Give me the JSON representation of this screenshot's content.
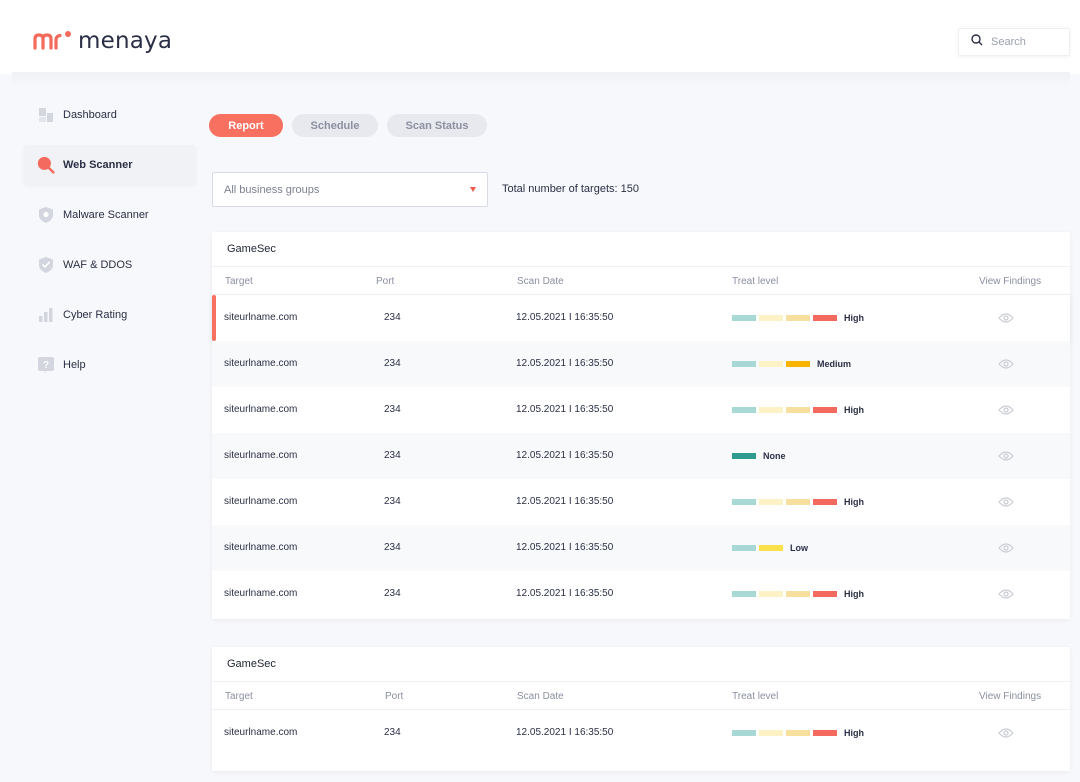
{
  "app": {
    "logo_text": "menaya"
  },
  "colors": {
    "accent": "#f87060",
    "teal": "#a8d8d6",
    "cream": "#fcf2c6",
    "tan": "#f7df9d",
    "high": "#f56a5e",
    "medium": "#f7b500",
    "none": "#2e9c8f",
    "low": "#fae04a"
  },
  "header": {
    "search_placeholder": "Search",
    "search_icon": "search-icon"
  },
  "sidebar": {
    "items": [
      {
        "label": "Dashboard",
        "icon": "dashboard-icon",
        "active": false
      },
      {
        "label": "Web Scanner",
        "icon": "web-scanner-icon",
        "active": true
      },
      {
        "label": "Malware Scanner",
        "icon": "malware-shield-icon",
        "active": false
      },
      {
        "label": "WAF & DDOS",
        "icon": "waf-shield-icon",
        "active": false
      },
      {
        "label": "Cyber Rating",
        "icon": "bar-chart-icon",
        "active": false
      },
      {
        "label": "Help",
        "icon": "help-icon",
        "active": false
      }
    ]
  },
  "tabs": [
    {
      "label": "Report",
      "active": true
    },
    {
      "label": "Schedule",
      "active": false
    },
    {
      "label": "Scan Status",
      "active": false
    }
  ],
  "filter": {
    "selected": "All business groups",
    "total_text": "Total number of targets: 150"
  },
  "columns": {
    "target": "Target",
    "port": "Port",
    "scan_date": "Scan Date",
    "treat_level": "Treat level",
    "view_findings": "View Findings"
  },
  "panels": [
    {
      "title": "GameSec",
      "rows": [
        {
          "target": "siteurlname.com",
          "port": "234",
          "date": "12.05.2021 I 16:35:50",
          "level": "High"
        },
        {
          "target": "siteurlname.com",
          "port": "234",
          "date": "12.05.2021 I 16:35:50",
          "level": "Medium"
        },
        {
          "target": "siteurlname.com",
          "port": "234",
          "date": "12.05.2021 I 16:35:50",
          "level": "High"
        },
        {
          "target": "siteurlname.com",
          "port": "234",
          "date": "12.05.2021 I 16:35:50",
          "level": "None"
        },
        {
          "target": "siteurlname.com",
          "port": "234",
          "date": "12.05.2021 I 16:35:50",
          "level": "High"
        },
        {
          "target": "siteurlname.com",
          "port": "234",
          "date": "12.05.2021 I 16:35:50",
          "level": "Low"
        },
        {
          "target": "siteurlname.com",
          "port": "234",
          "date": "12.05.2021 I 16:35:50",
          "level": "High"
        }
      ]
    },
    {
      "title": "GameSec",
      "rows": [
        {
          "target": "siteurlname.com",
          "port": "234",
          "date": "12.05.2021 I 16:35:50",
          "level": "High"
        }
      ]
    }
  ]
}
